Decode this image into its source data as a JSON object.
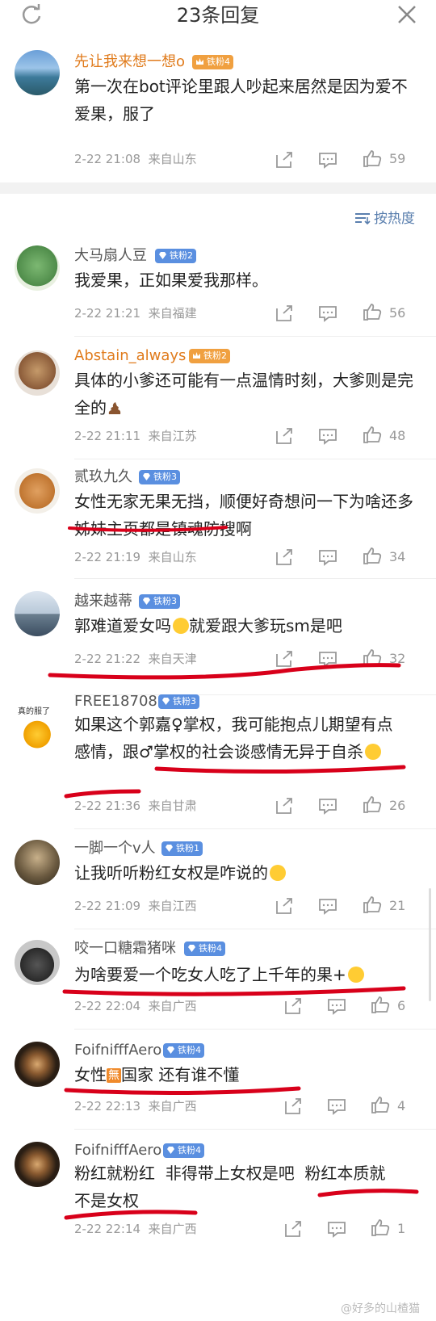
{
  "header": {
    "title": "23条回复"
  },
  "root_comment": {
    "username": "先让我来想一想o",
    "badge": "铁粉4",
    "text": "第一次在bot评论里跟人吵起来居然是因为爱不爱果，服了",
    "time": "2-22 21:08",
    "location": "来自山东",
    "likes": "59"
  },
  "sort": {
    "label": "按热度"
  },
  "replies": [
    {
      "username": "大马扇人豆",
      "badge": "铁粉2",
      "text": "我爱果，正如果爱我那样。",
      "time": "2-22 21:21",
      "location": "来自福建",
      "likes": "56"
    },
    {
      "username": "Abstain_always",
      "badge": "铁粉2",
      "text": "具体的小爹还可能有一点温情时刻，大爹则是完全的",
      "time": "2-22 21:11",
      "location": "来自江苏",
      "likes": "48"
    },
    {
      "username": "贰玖九久",
      "badge": "铁粉3",
      "text": "女性无家无果无挡，顺便好奇想问一下为啥还多姊妹主页都是镇魂防搜啊",
      "time": "2-22 21:19",
      "location": "来自山东",
      "likes": "34"
    },
    {
      "username": "越来越蒂",
      "badge": "铁粉3",
      "text_a": "郭难道爱女吗",
      "text_b": "就爱跟大爹玩sm是吧",
      "time": "2-22 21:22",
      "location": "来自天津",
      "likes": "32"
    },
    {
      "username": "FREE18708",
      "badge": "铁粉3",
      "avatar_caption": "真的服了",
      "text": "如果这个郭嘉♀掌权，我可能抱点儿期望有点感情，跟♂掌权的社会谈感情无异于自杀",
      "time": "2-22 21:36",
      "location": "来自甘肃",
      "likes": "26"
    },
    {
      "username": "一脚一个v人",
      "badge": "铁粉1",
      "text": "让我听听粉红女权是咋说的",
      "time": "2-22 21:09",
      "location": "来自江西",
      "likes": "21"
    },
    {
      "username": "咬一口糖霜猪咪",
      "badge": "铁粉4",
      "text": "为啥要爱一个吃女人吃了上千年的果+",
      "time": "2-22 22:04",
      "location": "来自广西",
      "likes": "6"
    },
    {
      "username": "FoifnifffAero",
      "badge": "铁粉4",
      "text_a": "女性",
      "wu": "無",
      "text_b": "国家 还有谁不懂",
      "time": "2-22 22:13",
      "location": "来自广西",
      "likes": "4"
    },
    {
      "username": "FoifnifffAero",
      "badge": "铁粉4",
      "text": "粉红就粉红  非得带上女权是吧  粉红本质就不是女权",
      "time": "2-22 22:14",
      "location": "来自广西",
      "likes": "1"
    }
  ],
  "watermark": "@好多的山楂猫",
  "colors": {
    "badge_blue": "#5a8fe0",
    "badge_orange": "#f0a040",
    "username_orange": "#e07b1c",
    "link_blue": "#5a7fae",
    "red_mark": "#d8001a"
  }
}
